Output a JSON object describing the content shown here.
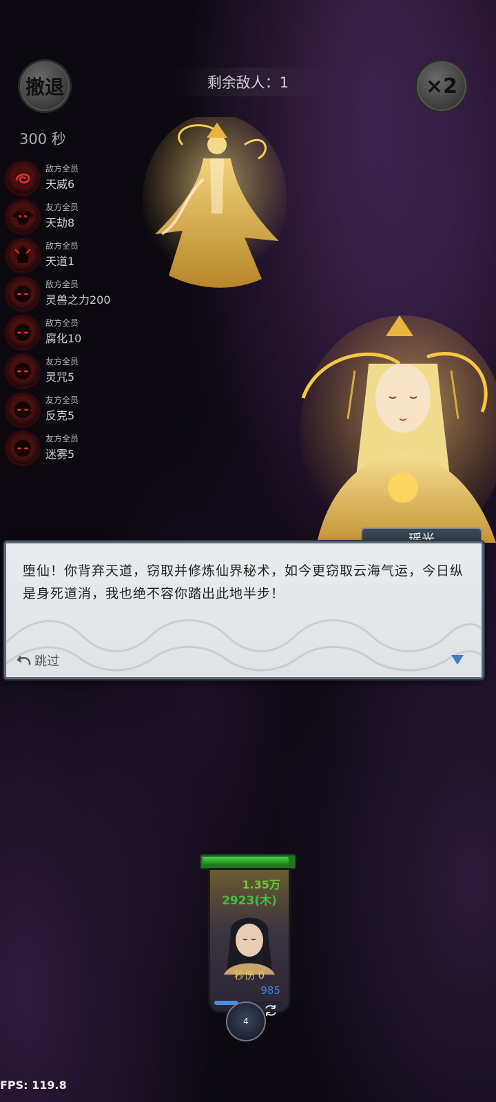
{
  "top": {
    "retreat_label": "撤退",
    "speed_label": "×2",
    "enemies_left": "剩余敌人：1",
    "timer": "300 秒"
  },
  "buffs": [
    {
      "category": "敌方全员",
      "value": "天威6"
    },
    {
      "category": "友方全员",
      "value": "天劫8"
    },
    {
      "category": "敌方全员",
      "value": "天道1"
    },
    {
      "category": "敌方全员",
      "value": "灵兽之力200"
    },
    {
      "category": "敌方全员",
      "value": "腐化10"
    },
    {
      "category": "友方全员",
      "value": "灵咒5"
    },
    {
      "category": "友方全员",
      "value": "反克5"
    },
    {
      "category": "友方全员",
      "value": "迷雾5"
    }
  ],
  "dialog": {
    "speaker": "瑶光",
    "text": "堕仙！你背弃天道，窃取并修炼仙界秘术，如今更窃取云海气运，今日纵是身死道消，我也绝不容你踏出此地半步！",
    "skip_label": "跳过"
  },
  "hero": {
    "hp_text": "1.35万",
    "attack_text": "2923(木)",
    "dps_text": "秒伤 0",
    "mana_text": "985",
    "skill_level": "4",
    "hp_fraction": 0.98,
    "mana_fraction": 0.35
  },
  "fps": "FPS: 119.8",
  "colors": {
    "hp_green": "#3fc13f",
    "mana_blue": "#3f86d8",
    "gold": "#e6c25a",
    "buff_red": "#b41414"
  }
}
